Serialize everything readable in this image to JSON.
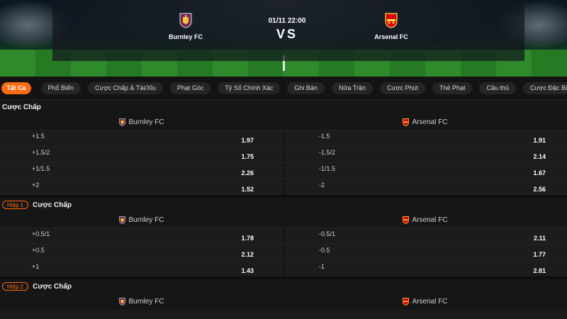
{
  "match": {
    "time": "01/11 22:00",
    "vs": "VS",
    "home": {
      "name": "Burnley FC",
      "crest_color": "#7a263a"
    },
    "away": {
      "name": "Arsenal FC",
      "crest_color": "#db0007"
    }
  },
  "tabs": [
    {
      "label": "Tất Cả",
      "active": true
    },
    {
      "label": "Phổ Biến"
    },
    {
      "label": "Cược Chấp & Tài/Xỉu"
    },
    {
      "label": "Phạt Góc"
    },
    {
      "label": "Tỷ Số Chính Xác"
    },
    {
      "label": "Ghi Bàn"
    },
    {
      "label": "Nửa Trận"
    },
    {
      "label": "Cược Phút"
    },
    {
      "label": "Thẻ Phạt"
    },
    {
      "label": "Cầu thủ"
    },
    {
      "label": "Cược Đặc Biệt"
    }
  ],
  "accent_color": "#ff6a13",
  "sections": [
    {
      "title": "Cược Chấp",
      "badge": "",
      "home": "Burnley FC",
      "away": "Arsenal FC",
      "rows": [
        {
          "home_line": "+1.5",
          "home_odds": "1.97",
          "away_line": "-1.5",
          "away_odds": "1.91"
        },
        {
          "home_line": "+1.5/2",
          "home_odds": "1.75",
          "away_line": "-1.5/2",
          "away_odds": "2.14"
        },
        {
          "home_line": "+1/1.5",
          "home_odds": "2.26",
          "away_line": "-1/1.5",
          "away_odds": "1.67"
        },
        {
          "home_line": "+2",
          "home_odds": "1.52",
          "away_line": "-2",
          "away_odds": "2.56"
        }
      ]
    },
    {
      "title": "Cược Chấp",
      "badge": "Hiệp 1",
      "home": "Burnley FC",
      "away": "Arsenal FC",
      "rows": [
        {
          "home_line": "+0.5/1",
          "home_odds": "1.78",
          "away_line": "-0.5/1",
          "away_odds": "2.11"
        },
        {
          "home_line": "+0.5",
          "home_odds": "2.12",
          "away_line": "-0.5",
          "away_odds": "1.77"
        },
        {
          "home_line": "+1",
          "home_odds": "1.43",
          "away_line": "-1",
          "away_odds": "2.81"
        }
      ]
    },
    {
      "title": "Cược Chấp",
      "badge": "Hiệp 2",
      "home": "Burnley FC",
      "away": "Arsenal FC",
      "rows": []
    }
  ]
}
